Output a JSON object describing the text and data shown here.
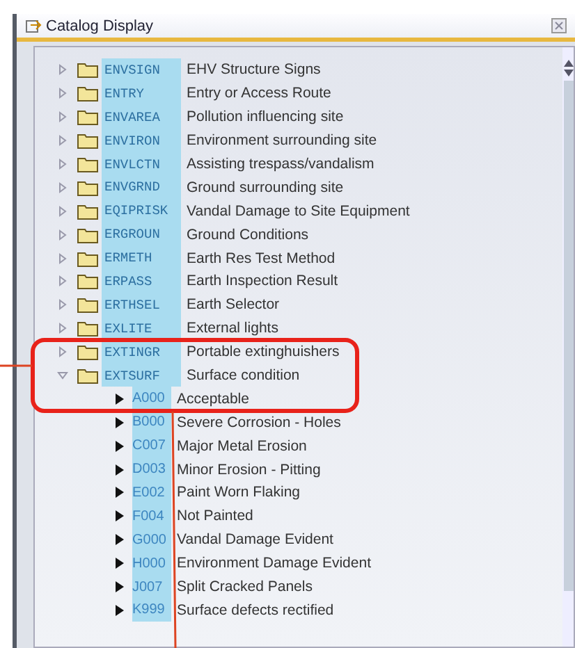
{
  "window": {
    "title": "Catalog Display"
  },
  "tree": [
    {
      "code": "ENVSIGN",
      "text": "EHV Structure Signs",
      "expanded": false
    },
    {
      "code": "ENTRY",
      "text": "Entry or Access Route",
      "expanded": false
    },
    {
      "code": "ENVAREA",
      "text": "Pollution influencing site",
      "expanded": false
    },
    {
      "code": "ENVIRON",
      "text": "Environment surrounding site",
      "expanded": false
    },
    {
      "code": "ENVLCTN",
      "text": "Assisting trespass/vandalism",
      "expanded": false
    },
    {
      "code": "ENVGRND",
      "text": "Ground surrounding site",
      "expanded": false
    },
    {
      "code": "EQIPRISK",
      "text": "Vandal Damage to Site Equipment",
      "expanded": false
    },
    {
      "code": "ERGROUN",
      "text": "Ground Conditions",
      "expanded": false
    },
    {
      "code": "ERMETH",
      "text": "Earth Res Test Method",
      "expanded": false
    },
    {
      "code": "ERPASS",
      "text": "Earth Inspection Result",
      "expanded": false
    },
    {
      "code": "ERTHSEL",
      "text": "Earth Selector",
      "expanded": false
    },
    {
      "code": "EXLITE",
      "text": "External lights",
      "expanded": false
    },
    {
      "code": "EXTINGR",
      "text": "Portable extinghuishers",
      "expanded": false
    },
    {
      "code": "EXTSURF",
      "text": "Surface condition",
      "expanded": true,
      "children": [
        {
          "code": "A000",
          "text": "Acceptable"
        },
        {
          "code": "B000",
          "text": "Severe Corrosion - Holes"
        },
        {
          "code": "C007",
          "text": "Major Metal Erosion"
        },
        {
          "code": "D003",
          "text": "Minor Erosion - Pitting"
        },
        {
          "code": "E002",
          "text": "Paint Worn Flaking"
        },
        {
          "code": "F004",
          "text": "Not Painted"
        },
        {
          "code": "G000",
          "text": "Vandal Damage Evident"
        },
        {
          "code": "H000",
          "text": "Environment Damage Evident"
        },
        {
          "code": "J007",
          "text": "Split Cracked Panels"
        },
        {
          "code": "K999",
          "text": "Surface defects rectified"
        }
      ]
    }
  ]
}
